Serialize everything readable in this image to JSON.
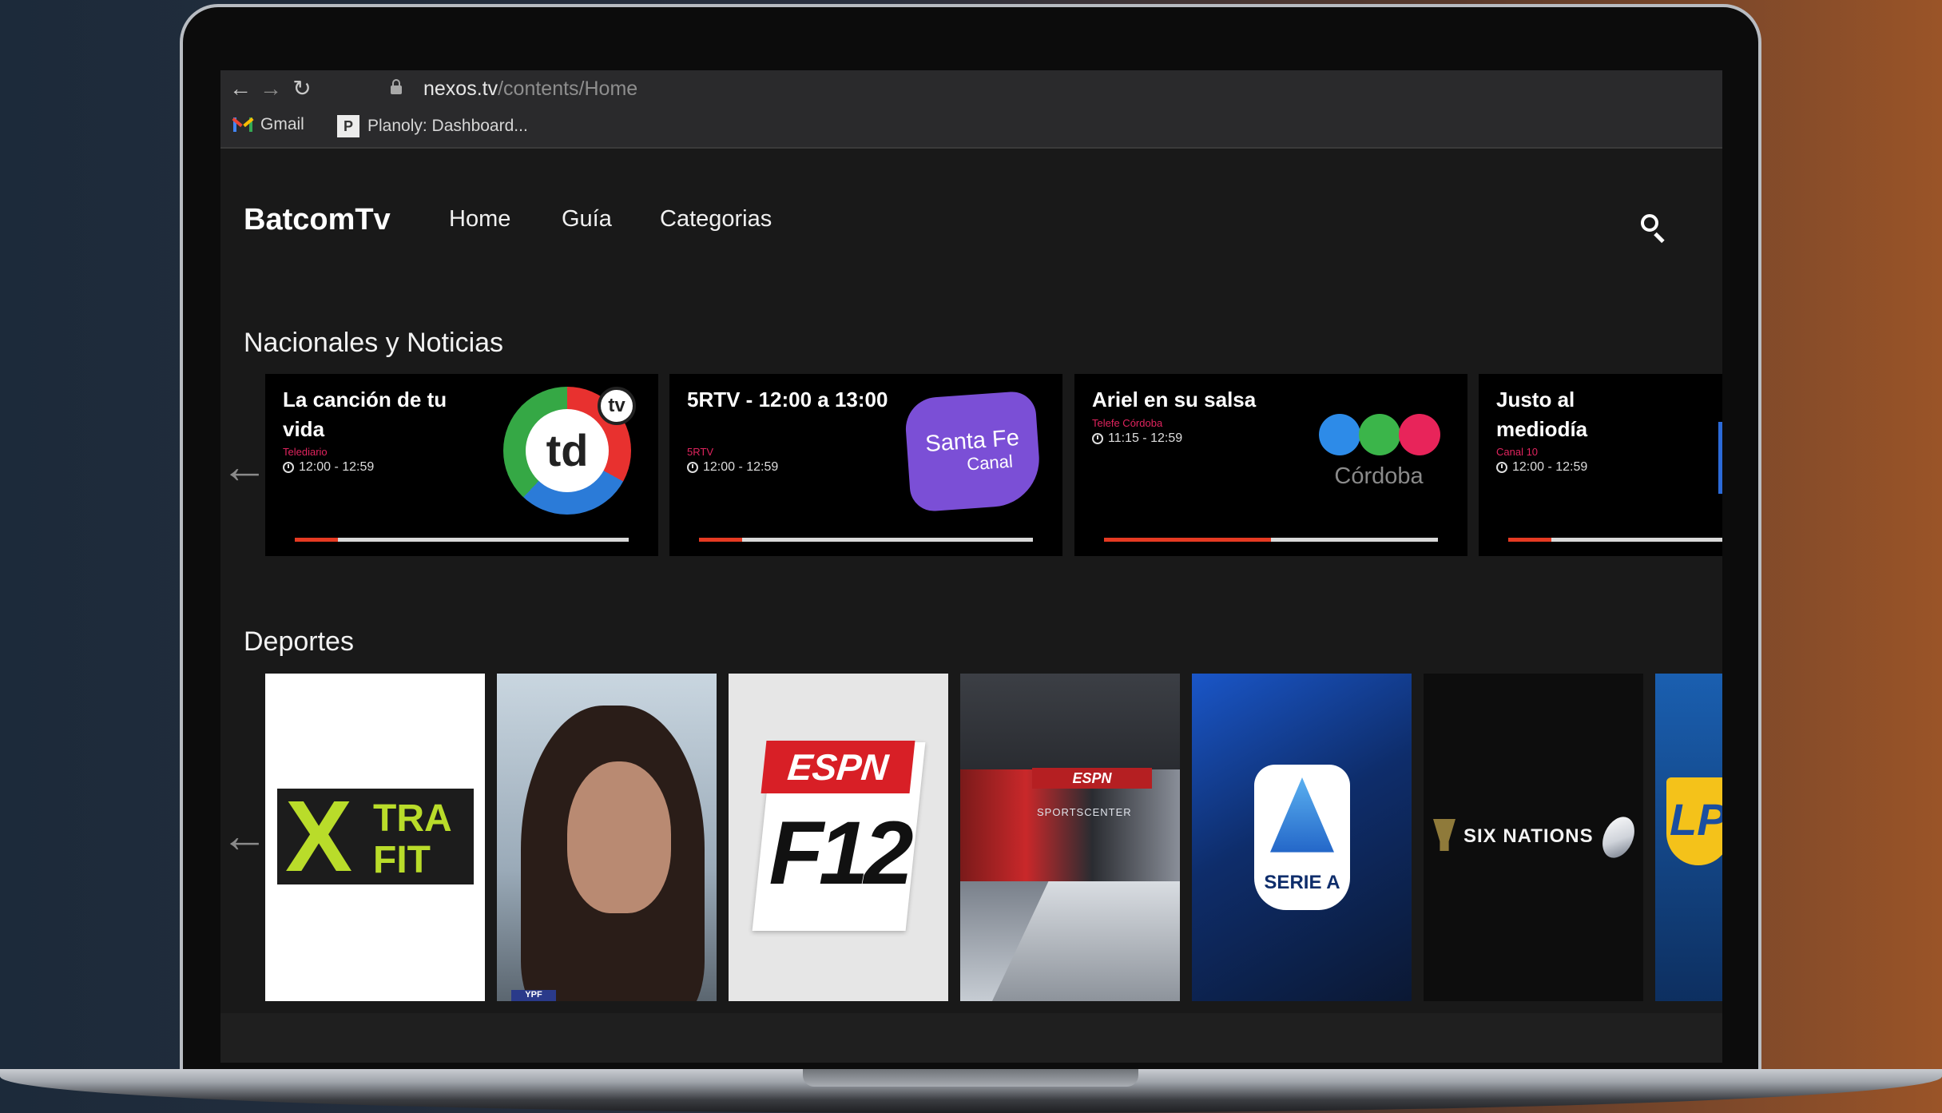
{
  "browser": {
    "url_host": "nexos.tv",
    "url_path": "/contents/Home",
    "bookmarks": [
      {
        "label": "Gmail",
        "icon": "gmail-icon"
      },
      {
        "label": "Planoly: Dashboard...",
        "icon": "planoly-icon"
      }
    ]
  },
  "header": {
    "brand": "BatcomTv",
    "nav": [
      "Home",
      "Guía",
      "Categorias"
    ]
  },
  "sections": {
    "news": {
      "title": "Nacionales y Noticias",
      "cards": [
        {
          "title": "La canción de tu vida",
          "channel": "Telediario",
          "time": "12:00 - 12:59",
          "progress": 0.13,
          "logo": "td-tv-logo"
        },
        {
          "title": "5RTV - 12:00 a 13:00",
          "channel": "5RTV",
          "time": "12:00 - 12:59",
          "progress": 0.13,
          "logo": "santa-fe-canal-logo",
          "logo_line1": "Santa Fe",
          "logo_line2": "Canal"
        },
        {
          "title": "Ariel en su salsa",
          "channel": "Telefe Córdoba",
          "time": "11:15 - 12:59",
          "progress": 0.5,
          "logo": "cordoba-logo",
          "logo_word": "Córdoba"
        },
        {
          "title": "Justo al mediodía",
          "channel": "Canal 10",
          "time": "12:00 - 12:59",
          "progress": 0.13,
          "logo": "partial-logo"
        }
      ]
    },
    "sports": {
      "title": "Deportes",
      "tiles": [
        {
          "name": "xtra-fit",
          "text1": "X",
          "text2": "TRA",
          "text3": "FIT"
        },
        {
          "name": "portrait-woman",
          "tag": "YPF"
        },
        {
          "name": "espn-f12",
          "text1": "ESPN",
          "text2": "F12"
        },
        {
          "name": "sportscenter-studio",
          "text1": "ESPN",
          "text2": "SPORTSCENTER"
        },
        {
          "name": "serie-a",
          "text1": "SERIE A"
        },
        {
          "name": "six-nations",
          "text1": "SIX NATIONS"
        },
        {
          "name": "lpf",
          "text1": "LP"
        }
      ]
    }
  },
  "colors": {
    "accent_red": "#e63a22",
    "channel_pink": "#e0245e",
    "santafe_purple": "#7b4fd6",
    "cordoba_dots": [
      "#2d8be8",
      "#3bb54a",
      "#e8245a"
    ]
  }
}
